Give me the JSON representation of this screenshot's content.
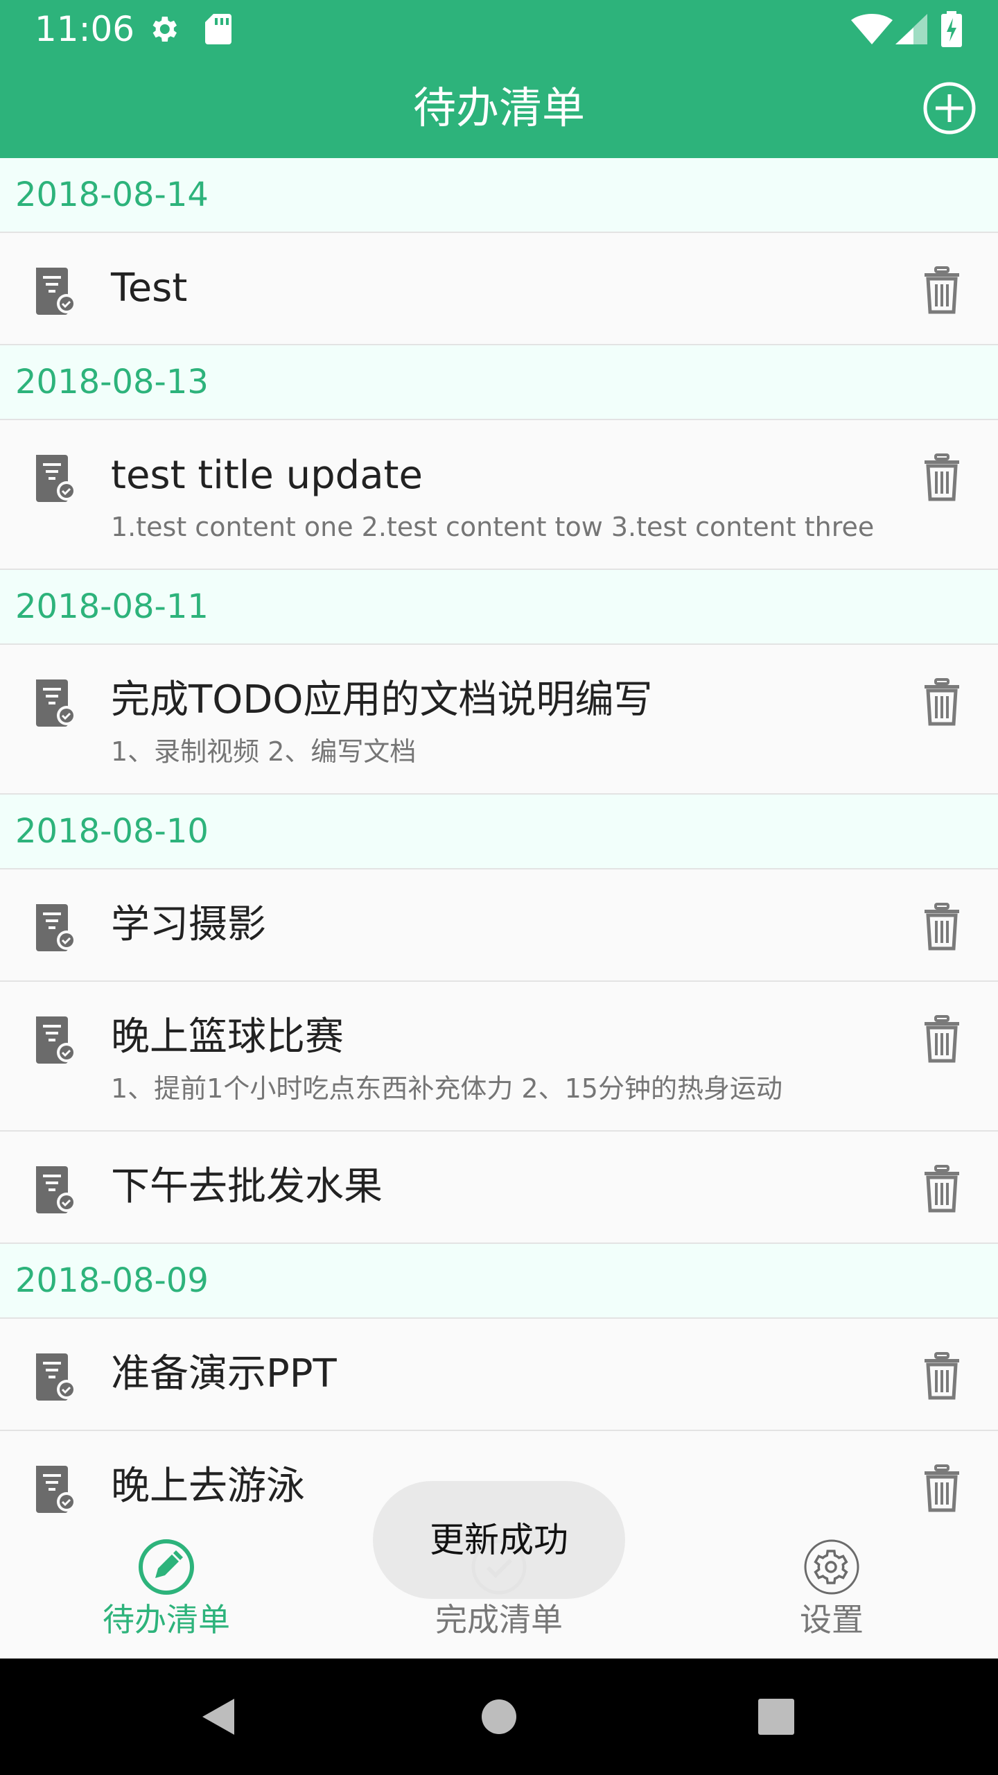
{
  "status_bar": {
    "time": "11:06",
    "icons": [
      "gear-icon",
      "sd-card-icon",
      "wifi-icon",
      "signal-icon",
      "battery-charging-icon"
    ]
  },
  "app_bar": {
    "title": "待办清单",
    "add_icon": "add-circle-icon"
  },
  "list": {
    "groups": [
      {
        "date": "2018-08-14",
        "items": [
          {
            "title": "Test",
            "content": ""
          }
        ]
      },
      {
        "date": "2018-08-13",
        "items": [
          {
            "title": "test title update",
            "content": "1.test content one 2.test content tow 3.test content three"
          }
        ]
      },
      {
        "date": "2018-08-11",
        "items": [
          {
            "title": "完成TODO应用的文档说明编写",
            "content": "1、录制视频 2、编写文档"
          }
        ]
      },
      {
        "date": "2018-08-10",
        "items": [
          {
            "title": "学习摄影",
            "content": ""
          },
          {
            "title": "晚上篮球比赛",
            "content": "1、提前1个小时吃点东西补充体力 2、15分钟的热身运动"
          },
          {
            "title": "下午去批发水果",
            "content": ""
          }
        ]
      },
      {
        "date": "2018-08-09",
        "items": [
          {
            "title": "准备演示PPT",
            "content": ""
          },
          {
            "title": "晚上去游泳",
            "content": ""
          }
        ]
      }
    ]
  },
  "bottom_nav": {
    "items": [
      {
        "label": "待办清单",
        "icon": "pencil-circle-icon",
        "active": true
      },
      {
        "label": "完成清单",
        "icon": "check-circle-icon",
        "active": false
      },
      {
        "label": "设置",
        "icon": "settings-circle-icon",
        "active": false
      }
    ]
  },
  "toast": {
    "text": "更新成功"
  },
  "colors": {
    "primary": "#2db37b",
    "date_header_bg": "#f2fffb",
    "icon_gray": "#6b6b6b"
  }
}
